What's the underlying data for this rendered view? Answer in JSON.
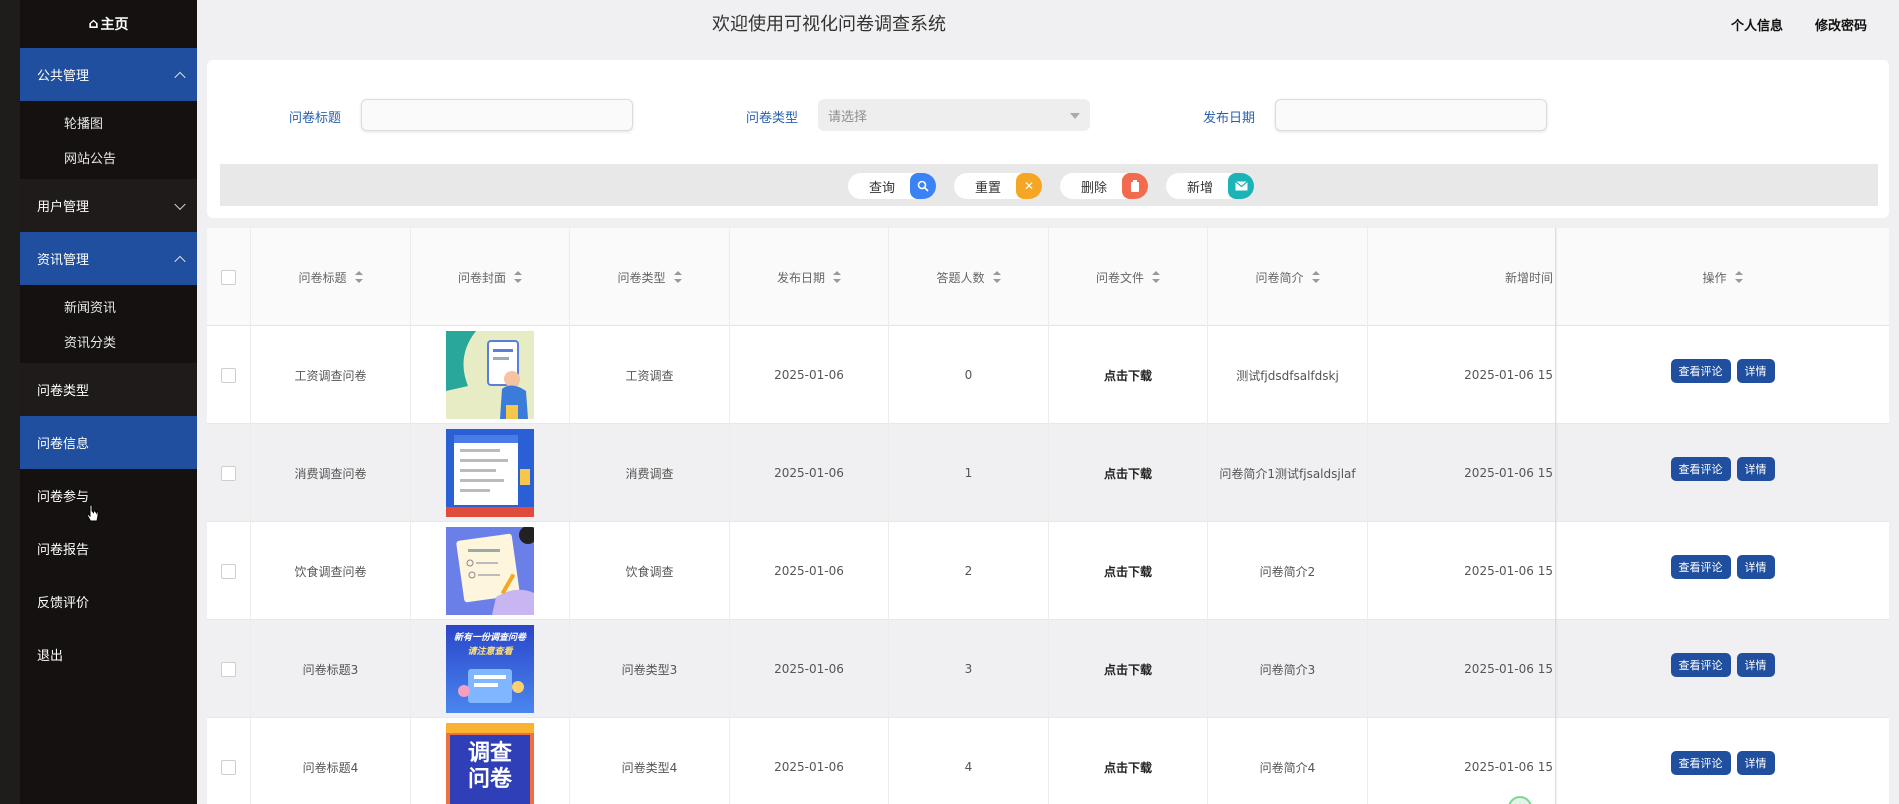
{
  "sidebar": {
    "home": "主页",
    "items": [
      {
        "label": "公共管理",
        "active": true,
        "expanded": true,
        "children": [
          {
            "label": "轮播图"
          },
          {
            "label": "网站公告"
          }
        ]
      },
      {
        "label": "用户管理",
        "active": false,
        "expanded": false
      },
      {
        "label": "资讯管理",
        "active": true,
        "expanded": true,
        "children": [
          {
            "label": "新闻资讯"
          },
          {
            "label": "资讯分类"
          }
        ]
      },
      {
        "label": "问卷类型",
        "active": false
      },
      {
        "label": "问卷信息",
        "active": true
      },
      {
        "label": "问卷参与",
        "active": false
      },
      {
        "label": "问卷报告",
        "active": false
      },
      {
        "label": "反馈评价",
        "active": false
      },
      {
        "label": "退出",
        "active": false
      }
    ]
  },
  "header": {
    "title": "欢迎使用可视化问卷调查系统",
    "profile": "个人信息",
    "change_password": "修改密码"
  },
  "search": {
    "title_label": "问卷标题",
    "type_label": "问卷类型",
    "type_placeholder": "请选择",
    "date_label": "发布日期"
  },
  "buttons": {
    "query": "查询",
    "reset": "重置",
    "delete": "删除",
    "add": "新增"
  },
  "table": {
    "columns": [
      "问卷标题",
      "问卷封面",
      "问卷类型",
      "发布日期",
      "答题人数",
      "问卷文件",
      "问卷简介",
      "新增时间",
      "操作"
    ],
    "rows": [
      {
        "title": "工资调查问卷",
        "type": "工资调查",
        "date": "2025-01-06",
        "count": "0",
        "file": "点击下载",
        "intro": "测试fjdsdfsalfdskj",
        "created": "2025-01-06 15"
      },
      {
        "title": "消费调查问卷",
        "type": "消费调查",
        "date": "2025-01-06",
        "count": "1",
        "file": "点击下载",
        "intro": "问卷简介1测试fjsaldsjlaf",
        "created": "2025-01-06 15"
      },
      {
        "title": "饮食调查问卷",
        "type": "饮食调查",
        "date": "2025-01-06",
        "count": "2",
        "file": "点击下载",
        "intro": "问卷简介2",
        "created": "2025-01-06 15"
      },
      {
        "title": "问卷标题3",
        "type": "问卷类型3",
        "date": "2025-01-06",
        "count": "3",
        "file": "点击下载",
        "intro": "问卷简介3",
        "created": "2025-01-06 15"
      },
      {
        "title": "问卷标题4",
        "type": "问卷类型4",
        "date": "2025-01-06",
        "count": "4",
        "file": "点击下载",
        "intro": "问卷简介4",
        "created": "2025-01-06 15"
      }
    ],
    "actions": {
      "comments": "查看评论",
      "detail": "详情"
    },
    "covers": [
      {
        "text": ""
      },
      {
        "text": ""
      },
      {
        "text": ""
      },
      {
        "line1": "新有一份调查问卷",
        "line2": "请注意查看"
      },
      {
        "line1": "调查",
        "line2": "问卷"
      }
    ]
  },
  "colors": {
    "sidebar_active": "#1f4f9e",
    "accent_blue": "#2a5fae",
    "query_icon": "#3b82f6",
    "reset_icon": "#f5a623",
    "delete_icon": "#f26b4f",
    "add_icon": "#19b3b8"
  }
}
